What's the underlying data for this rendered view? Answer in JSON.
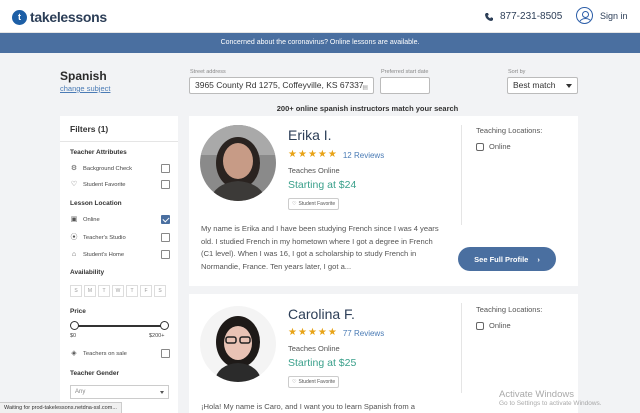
{
  "header": {
    "logo": "takelessons",
    "phone": "877-231-8505",
    "signin": "Sign in"
  },
  "banner": "Concerned about the coronavirus? Online lessons are available.",
  "search": {
    "subject": "Spanish",
    "change_subject": "change subject",
    "address_label": "Street address",
    "address_value": "3965 County Rd 1275, Coffeyville, KS 67337",
    "date_label": "Preferred start date",
    "date_value": "",
    "sort_label": "Sort by",
    "sort_value": "Best match",
    "match_count": "200+ online spanish instructors match your search"
  },
  "filters": {
    "title": "Filters (1)",
    "attributes_title": "Teacher Attributes",
    "background_check": "Background Check",
    "student_favorite": "Student Favorite",
    "location_title": "Lesson Location",
    "online": "Online",
    "teachers_studio": "Teacher's Studio",
    "students_home": "Student's Home",
    "availability_title": "Availability",
    "days": [
      "S",
      "M",
      "T",
      "W",
      "T",
      "F",
      "S"
    ],
    "price_title": "Price",
    "price_min": "$0",
    "price_max": "$200+",
    "teachers_on_sale": "Teachers on sale",
    "gender_title": "Teacher Gender",
    "gender_value": "Any"
  },
  "teachers": [
    {
      "name": "Erika I.",
      "rating": 5,
      "reviews": "12 Reviews",
      "teaches": "Teaches Online",
      "price": "Starting at $24",
      "badge": "Student Favorite",
      "bio": "My name is Erika and I have been studying French since I was 4 years old. I studied French in my hometown where I got a degree in French (C1 level). When I was 16, I got a scholarship to study French in Normandie, France. Ten years later, I got a...",
      "loc_title": "Teaching Locations:",
      "loc_online": "Online",
      "profile_button": "See Full Profile"
    },
    {
      "name": "Carolina F.",
      "rating": 5,
      "reviews": "77 Reviews",
      "teaches": "Teaches Online",
      "price": "Starting at $25",
      "badge": "Student Favorite",
      "bio": "¡Hola! My name is Caro, and I want you to learn Spanish from a",
      "loc_title": "Teaching Locations:",
      "loc_online": "Online"
    }
  ],
  "status_bar": "Waiting for prod-takelessons.netdna-ssl.com...",
  "watermark": {
    "line1": "Activate Windows",
    "line2": "Go to Settings to activate Windows."
  }
}
